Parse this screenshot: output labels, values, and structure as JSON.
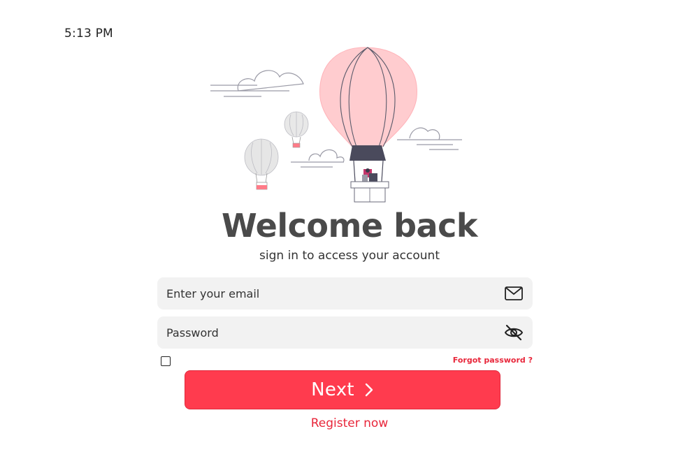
{
  "status_bar": {
    "time": "5:13 PM"
  },
  "illustration": {
    "icon": "hot-air-balloon-illustration",
    "colors": {
      "balloon_main": "#ffcccf",
      "balloon_grey": "#e6e6e6",
      "basket": "#4a4a5a",
      "outline": "#555566"
    }
  },
  "header": {
    "title": "Welcome back",
    "subtitle": "sign in to access your account"
  },
  "form": {
    "email": {
      "placeholder": "Enter your email",
      "value": "",
      "icon": "mail-icon"
    },
    "password": {
      "placeholder": "Password",
      "value": "",
      "icon": "eye-off-icon"
    },
    "remember_checked": false,
    "forgot_label": "Forgot password ?",
    "next_label": "Next",
    "register_label": "Register now"
  },
  "colors": {
    "accent": "#ff3b4e",
    "link": "#e8263a",
    "field_bg": "#f2f2f2",
    "title": "#4a4a4a"
  }
}
